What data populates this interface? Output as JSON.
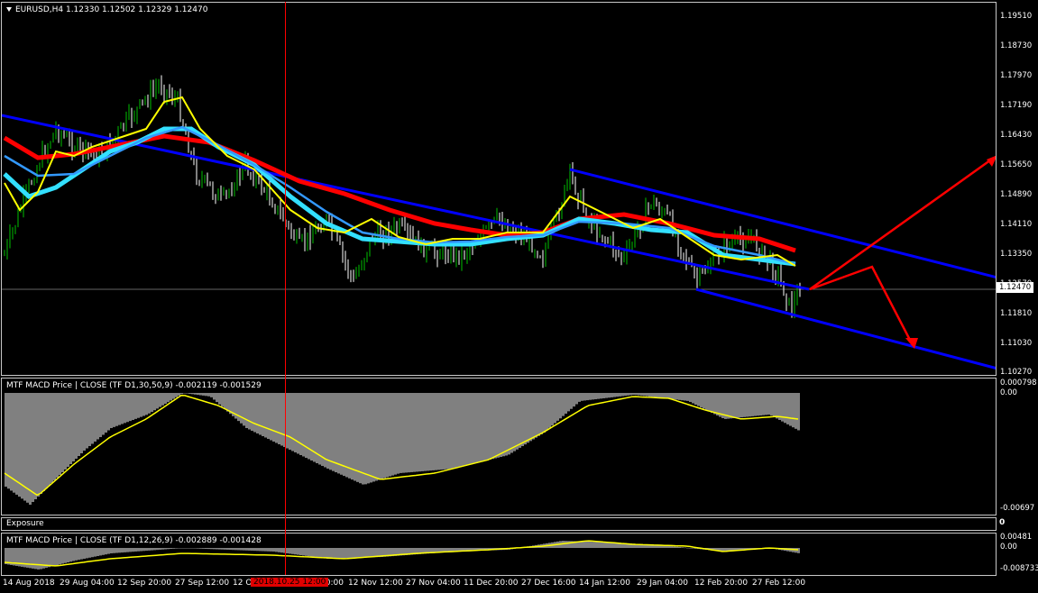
{
  "main": {
    "title": "EURUSD,H4  1.12330 1.12502 1.12329 1.12470",
    "price_labels": [
      "1.19510",
      "1.18730",
      "1.17970",
      "1.17190",
      "1.16430",
      "1.15650",
      "1.14890",
      "1.14110",
      "1.13350",
      "1.12570",
      "1.11810",
      "1.11030",
      "1.10270"
    ],
    "current_price": "1.12470"
  },
  "macd1": {
    "title": "MTF MACD Price | CLOSE  (TF D1,30,50,9) -0.002119 -0.001529",
    "labels": [
      "0.000798",
      "0.00",
      "-0.00697"
    ]
  },
  "exposure": {
    "title": "Exposure",
    "value": "0"
  },
  "macd2": {
    "title": "MTF MACD Price | CLOSE  (TF D1,12,26,9) -0.002889 -0.001428",
    "labels": [
      "0.00481",
      "0.00",
      "-0.008733"
    ]
  },
  "time_axis": [
    "14 Aug 2018",
    "29 Aug 04:00",
    "12 Sep 20:00",
    "27 Sep 12:00",
    "12 O",
    "20:00",
    "12 Nov 12:00",
    "27 Nov 04:00",
    "11 Dec 20:00",
    "27 Dec 16:00",
    "14 Jan 12:00",
    "29 Jan 04:00",
    "12 Feb 20:00",
    "27 Feb 12:00"
  ],
  "time_cursor": "2018.10.25 12:00",
  "colors": {
    "up_candle": "#00c000",
    "down_candle": "#ffffff",
    "ma_red": "#ff0000",
    "ma_cyan": "#33e0ff",
    "ma_blue": "#3399ff",
    "ma_yellow": "#ffff00",
    "channel": "#0000ff",
    "arrow": "#ff0000",
    "histogram": "#808080"
  }
}
